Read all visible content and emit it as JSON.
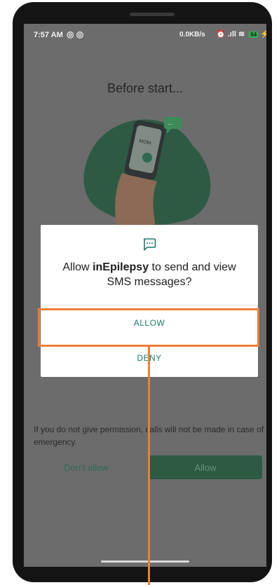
{
  "status_bar": {
    "time": "7:57 AM",
    "left_icons": "◎ ◎",
    "network_speed": "0.0KB/s",
    "system_icons": "⏰ .ıll ≋",
    "battery": "64",
    "charging": "⚡"
  },
  "background": {
    "title": "Before start...",
    "phone_screen_text": "MOM",
    "bubble_text": "...",
    "note": "If you do not give permission, calls will not be made in case of emergency.",
    "dont_allow_label": "Don't allow",
    "allow_label": "Allow"
  },
  "dialog": {
    "icon": "message-icon",
    "prompt_prefix": "Allow ",
    "app_name": "inEpilepsy",
    "prompt_suffix": " to send and view SMS messages?",
    "allow_label": "ALLOW",
    "deny_label": "DENY"
  },
  "colors": {
    "accent": "#1d7a6a",
    "highlight": "#ee7f33",
    "illustration_green": "#2e5a44"
  }
}
